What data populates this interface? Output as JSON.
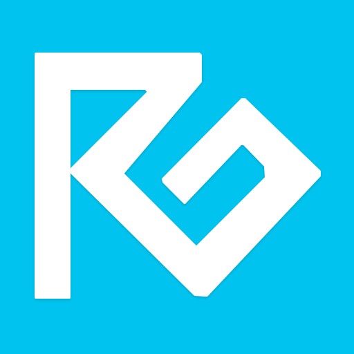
{
  "app_icon": {
    "icon": "rg-monogram-logo-icon",
    "colors": {
      "background": "#00C4EF",
      "foreground": "#FFFFFF",
      "shadow": "#0090B0"
    }
  }
}
